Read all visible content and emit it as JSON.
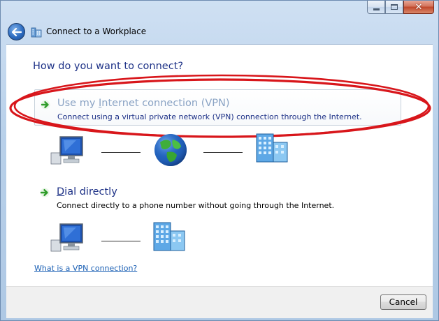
{
  "window": {
    "title": "Connect to a Workplace",
    "accent_color": "#1e3287",
    "close_glyph": "✕"
  },
  "content": {
    "heading": "How do you want to connect?",
    "options": [
      {
        "title_prefix": "Use my ",
        "title_key": "I",
        "title_suffix": "nternet connection (VPN)",
        "description": "Connect using a virtual private network (VPN) connection through the Internet.",
        "icon": "green-arrow-icon"
      },
      {
        "title_prefix": "",
        "title_key": "D",
        "title_suffix": "ial directly",
        "description": "Connect directly to a phone number without going through the Internet.",
        "icon": "green-arrow-icon"
      }
    ],
    "diagrams": {
      "vpn": [
        "computer-icon",
        "globe-icon",
        "workplace-building-icon"
      ],
      "dial": [
        "computer-icon",
        "workplace-building-icon"
      ]
    },
    "help_link": "What is a VPN connection?",
    "annotation_color": "#d8161b"
  },
  "footer": {
    "cancel_label": "Cancel"
  }
}
